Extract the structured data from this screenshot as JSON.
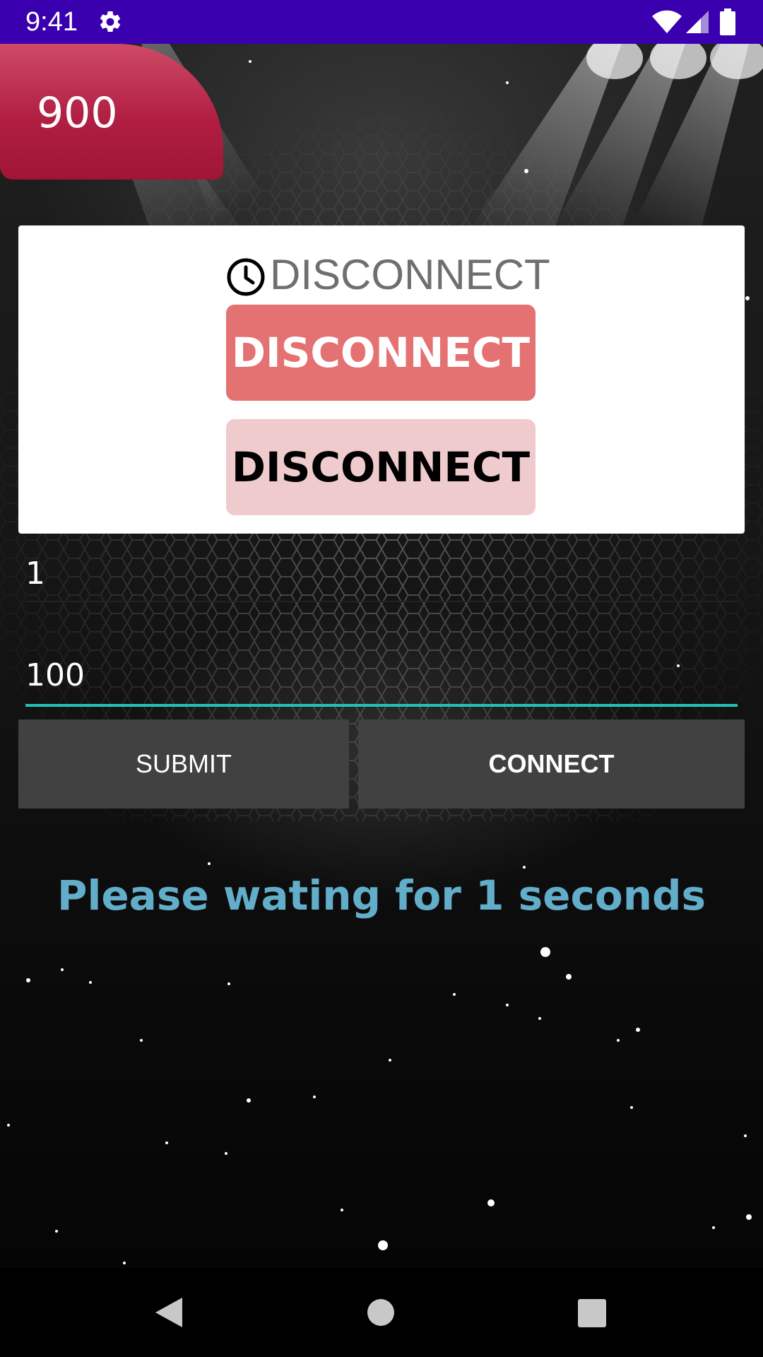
{
  "status_bar": {
    "time": "9:41",
    "icons": [
      "gear-icon",
      "wifi-icon",
      "signal-icon",
      "battery-icon"
    ],
    "color": "#3a00b0"
  },
  "score": {
    "value": "900",
    "color": "#b11f43"
  },
  "card": {
    "timer_icon": "clock-icon",
    "timer_label": "DISCONNECT",
    "primary_button_label": "DISCONNECT",
    "secondary_button_label": "DISCONNECT"
  },
  "inputs": {
    "field_1_value": "1",
    "field_2_value": "100",
    "focus_color": "#22c3b6"
  },
  "actions": {
    "submit_label": "SUBMIT",
    "connect_label": "CONNECT"
  },
  "message": {
    "text": "Please wating for 1 seconds",
    "color": "#62adc9"
  },
  "nav_bar": {
    "icons": [
      "back-icon",
      "home-icon",
      "recents-icon"
    ]
  }
}
